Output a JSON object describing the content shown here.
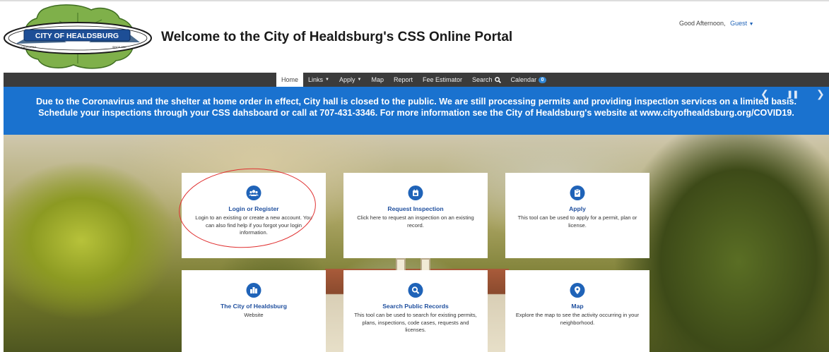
{
  "header": {
    "logo": {
      "text": "CITY OF HEALDSBURG",
      "left_caption": "CALIFORNIA",
      "right_caption": "SINCE 1867"
    },
    "title": "Welcome to the City of Healdsburg's CSS Online Portal",
    "greeting": "Good Afternoon,",
    "user": "Guest"
  },
  "nav": {
    "items": [
      {
        "label": "Home",
        "active": true
      },
      {
        "label": "Links",
        "dropdown": true
      },
      {
        "label": "Apply",
        "dropdown": true
      },
      {
        "label": "Map"
      },
      {
        "label": "Report"
      },
      {
        "label": "Fee Estimator"
      },
      {
        "label": "Search",
        "icon": "search-icon"
      },
      {
        "label": "Calendar",
        "badge": "0"
      }
    ]
  },
  "banner": {
    "text": "Due to the Coronavirus and the shelter at home order in effect, City hall is closed to the public. We are still processing permits and providing inspection services on a limited basis. Schedule your inspections through your CSS dahsboard or call at 707-431-3346. For more information see the City of Healdsburg's website at www.cityofhealdsburg.org/COVID19.",
    "prev_icon": "chevron-left-icon",
    "pause_icon": "pause-icon",
    "next_icon": "chevron-right-icon"
  },
  "cards": [
    {
      "icon": "users-icon",
      "title": "Login or Register",
      "desc": "Login to an existing or create a new account. You can also find help if you forgot your login information."
    },
    {
      "icon": "calendar-icon",
      "title": "Request Inspection",
      "desc": "Click here to request an inspection on an existing record."
    },
    {
      "icon": "clipboard-icon",
      "title": "Apply",
      "desc": "This tool can be used to apply for a permit, plan or license."
    },
    {
      "icon": "city-icon",
      "title": "The City of Healdsburg",
      "desc": "Website"
    },
    {
      "icon": "search-icon",
      "title": "Search Public Records",
      "desc": "This tool can be used to search for existing permits, plans, inspections, code cases, requests and licenses."
    },
    {
      "icon": "map-pin-icon",
      "title": "Map",
      "desc": "Explore the map to see the activity occurring in your neighborhood."
    }
  ],
  "colors": {
    "banner": "#1a72cf",
    "navbar": "#3b3b3b",
    "card_icon": "#1f63b8",
    "card_title": "#1f4f9e",
    "annotation": "#e03030"
  }
}
